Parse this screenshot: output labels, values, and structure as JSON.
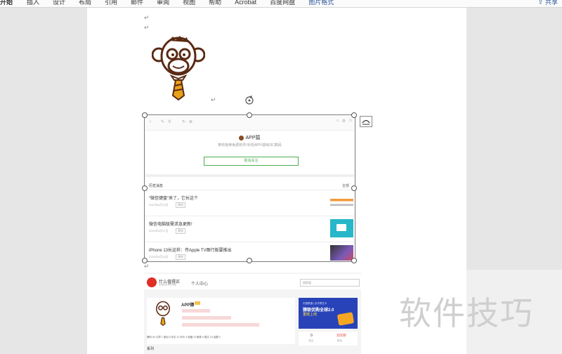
{
  "ribbon": {
    "tabs": [
      "开始",
      "插入",
      "设计",
      "布局",
      "引用",
      "邮件",
      "审阅",
      "视图",
      "帮助",
      "Acrobat",
      "百度网盘",
      "图片格式"
    ],
    "share_label": "共享"
  },
  "document": {
    "paragraph_mark": "↵"
  },
  "phone_screenshot": {
    "app_name": "APP猿",
    "app_desc": "带你各种免费软件/手机APP/游戏/3C数码",
    "follow_button": "取消关注",
    "section_title": "历史消息",
    "all_label": "全部",
    "articles": [
      {
        "title": "“微信键盘”来了，它长这个",
        "date": "2021年4月19日",
        "tag": "原创"
      },
      {
        "title": "微信电脑版需求急更新!",
        "date": "2021年4月17日",
        "tag": "原创"
      },
      {
        "title": "iPhone 13长这样：传Apple TV图行版要推出",
        "date": "2021年4月15日",
        "tag": "原创"
      }
    ]
  },
  "smzdm": {
    "site_name": "什么值得买",
    "site_sub": "认真生活 快乐消费",
    "personal_center": "个人中心",
    "search_placeholder": "搜索值",
    "user_name": "APP猿",
    "banner_small": "中国联通 | 京东联名卡",
    "banner_title": "猿联优购全球2.0",
    "banner_sub": "重磅上线",
    "count_left": "0",
    "count_right": "11539",
    "count_left_label": "关注",
    "count_right_label": "粉丝",
    "series_label": "系列",
    "stats_text": "爆料 54 文章 7 原创 8 评论 11 好价 3 收藏 10 晒单 9 图文 15 话题 0"
  },
  "watermark": "软件技巧",
  "colors": {
    "accent_blue": "#2b579a",
    "wechat_green": "#4caf50",
    "smzdm_red": "#e02e24",
    "banner_blue": "#2843b8"
  }
}
